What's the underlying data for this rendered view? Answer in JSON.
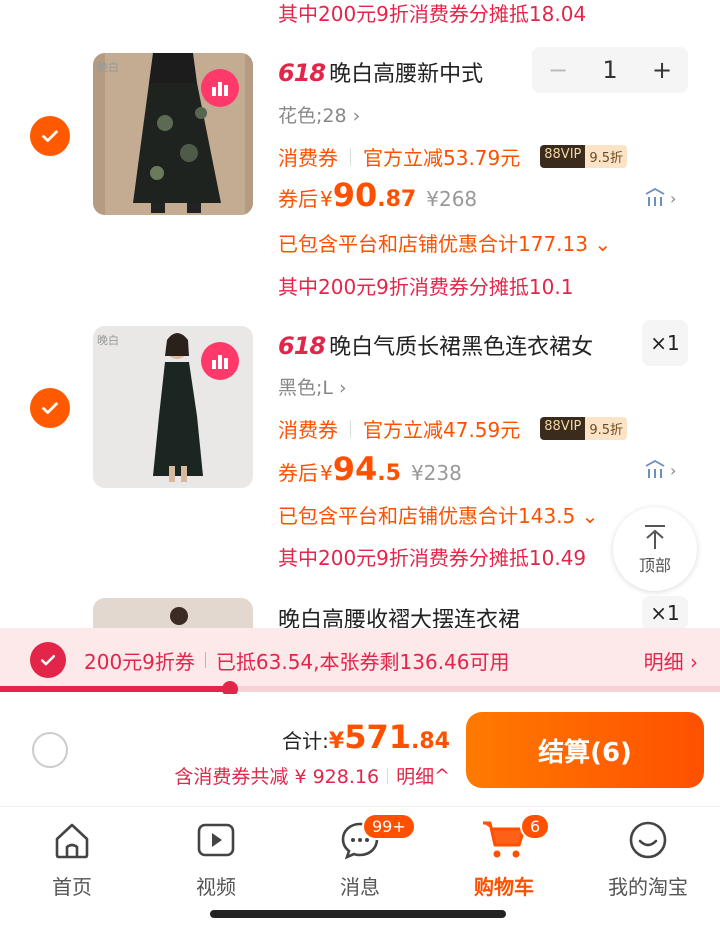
{
  "top_clip_text": "其中200元9折消费券分摊抵18.04",
  "items": [
    {
      "brand": "晚白",
      "tag": "618",
      "title": "晚白高腰新中式",
      "sku": "花色;28",
      "qty": "1",
      "coupon_tag": "消费券",
      "official_discount": "官方立减53.79元",
      "vip_label": "88VIP",
      "vip_discount": "9.5折",
      "price_label": "券后",
      "price_yen": "¥",
      "price_int": "90",
      "price_dec": ".87",
      "orig_price": "¥268",
      "discount_total": "已包含平台和店铺优惠合计177.13",
      "share_text": "其中200元9折消费券分摊抵10.1"
    },
    {
      "brand": "晚白",
      "tag": "618",
      "title": "晚白气质长裙黑色连衣裙女",
      "sku": "黑色;L",
      "qty": "×1",
      "coupon_tag": "消费券",
      "official_discount": "官方立减47.59元",
      "vip_label": "88VIP",
      "vip_discount": "9.5折",
      "price_label": "券后",
      "price_yen": "¥",
      "price_int": "94",
      "price_dec": ".5",
      "orig_price": "¥238",
      "discount_total": "已包含平台和店铺优惠合计143.5",
      "share_text": "其中200元9折消费券分摊抵10.49"
    },
    {
      "title": "晚白高腰收褶大摆连衣裙",
      "qty": "×1"
    }
  ],
  "back_to_top": "顶部",
  "coupon_bar": {
    "name": "200元9折券",
    "status": "已抵63.54,本张券剩136.46可用",
    "detail": "明细",
    "progress_fraction": 0.32
  },
  "summary": {
    "total_label": "合计:",
    "total_yen": "¥",
    "total_int": "571",
    "total_dec": ".84",
    "savings": "含消费券共减 ¥ 928.16",
    "savings_detail": "明细",
    "checkout_label": "结算(6)"
  },
  "tabs": [
    {
      "label": "首页"
    },
    {
      "label": "视频"
    },
    {
      "label": "消息",
      "badge": "99+"
    },
    {
      "label": "购物车",
      "badge": "6"
    },
    {
      "label": "我的淘宝"
    }
  ],
  "colors": {
    "accent": "#ff5000",
    "coupon_red": "#e4254a"
  }
}
